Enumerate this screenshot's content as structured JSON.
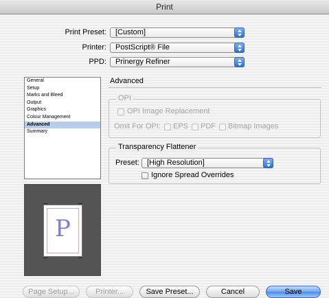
{
  "window": {
    "title": "Print"
  },
  "top": {
    "print_preset": {
      "label": "Print Preset:",
      "value": "[Custom]"
    },
    "printer": {
      "label": "Printer:",
      "value": "PostScript® File"
    },
    "ppd": {
      "label": "PPD:",
      "value": "Prinergy Refiner"
    }
  },
  "sidebar": {
    "items": [
      {
        "label": "General"
      },
      {
        "label": "Setup"
      },
      {
        "label": "Marks and Bleed"
      },
      {
        "label": "Output"
      },
      {
        "label": "Graphics"
      },
      {
        "label": "Colour Management"
      },
      {
        "label": "Advanced"
      },
      {
        "label": "Summary"
      }
    ],
    "selected": "Advanced"
  },
  "preview": {
    "letter": "P"
  },
  "panel": {
    "title": "Advanced",
    "opi": {
      "group_label": "OPI",
      "replacement_label": "OPI Image Replacement",
      "omit_label": "Omit For OPI:",
      "eps_label": "EPS",
      "pdf_label": "PDF",
      "bitmap_label": "Bitmap Images"
    },
    "flattener": {
      "group_label": "Transparency Flattener",
      "preset_label": "Preset:",
      "preset_value": "[High Resolution]",
      "ignore_label": "Ignore Spread Overrides"
    }
  },
  "buttons": {
    "page_setup": "Page Setup...",
    "printer": "Printer...",
    "save_preset": "Save Preset...",
    "cancel": "Cancel",
    "save": "Save"
  }
}
